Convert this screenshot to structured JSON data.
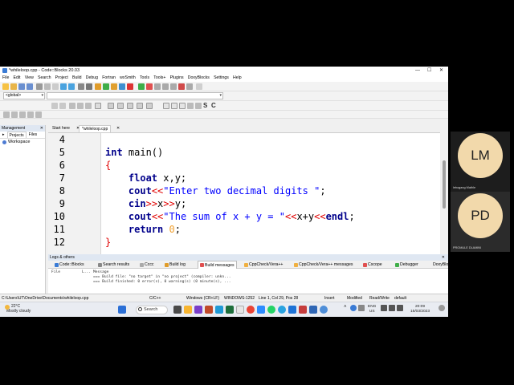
{
  "window": {
    "title": "*whileloop.cpp - Code::Blocks 20.03",
    "controls": [
      "—",
      "☐",
      "✕"
    ]
  },
  "menu": [
    "File",
    "Edit",
    "View",
    "Search",
    "Project",
    "Build",
    "Debug",
    "Fortran",
    "wxSmith",
    "Tools",
    "Tools+",
    "Plugins",
    "DoxyBlocks",
    "Settings",
    "Help"
  ],
  "toolbar": {
    "scope_combo": "<global>",
    "letters": [
      "S",
      "C"
    ]
  },
  "management": {
    "title": "Management",
    "close": "✕",
    "tabs": [
      "Projects",
      "Files"
    ],
    "arrow": "▸",
    "workspace_label": "Workspace"
  },
  "editor": {
    "tabs": [
      "Start here",
      "*whileloop.cpp"
    ],
    "line_numbers": [
      "4",
      "5",
      "6",
      "7",
      "8",
      "9",
      "10",
      "11",
      "12"
    ],
    "lines": [
      [],
      [
        {
          "c": "ty",
          "t": "int"
        },
        {
          "c": "",
          "t": " main()"
        }
      ],
      [
        {
          "c": "br",
          "t": "{"
        }
      ],
      [
        {
          "c": "",
          "t": "    "
        },
        {
          "c": "ty",
          "t": "float"
        },
        {
          "c": "",
          "t": " x,y;"
        }
      ],
      [
        {
          "c": "",
          "t": "    "
        },
        {
          "c": "kw",
          "t": "cout"
        },
        {
          "c": "op",
          "t": "<<"
        },
        {
          "c": "st",
          "t": "\"Enter two decimal digits \""
        },
        {
          "c": "",
          "t": ";"
        }
      ],
      [
        {
          "c": "",
          "t": "    "
        },
        {
          "c": "kw",
          "t": "cin"
        },
        {
          "c": "op",
          "t": ">>"
        },
        {
          "c": "",
          "t": "x"
        },
        {
          "c": "op",
          "t": ">>"
        },
        {
          "c": "",
          "t": "y;"
        }
      ],
      [
        {
          "c": "",
          "t": "    "
        },
        {
          "c": "kw",
          "t": "cout"
        },
        {
          "c": "op",
          "t": "<<"
        },
        {
          "c": "st",
          "t": "\"The sum of x + y = \""
        },
        {
          "c": "op",
          "t": "<<"
        },
        {
          "c": "",
          "t": "x+y"
        },
        {
          "c": "op",
          "t": "<<"
        },
        {
          "c": "kw",
          "t": "endl"
        },
        {
          "c": "",
          "t": ";"
        }
      ],
      [
        {
          "c": "",
          "t": "    "
        },
        {
          "c": "kw",
          "t": "return"
        },
        {
          "c": "",
          "t": " "
        },
        {
          "c": "nm",
          "t": "0"
        },
        {
          "c": "",
          "t": ";"
        }
      ],
      [
        {
          "c": "br",
          "t": "}"
        }
      ]
    ]
  },
  "logs": {
    "title": "Logs & others",
    "close": "✕",
    "tabs": [
      "Code::Blocks",
      "Search results",
      "Cccc",
      "Build log",
      "Build messages",
      "CppCheck/Vera++",
      "CppCheck/Vera++ messages",
      "Cscope",
      "Debugger",
      "DoxyBlocks"
    ],
    "columns": [
      "File",
      "L...",
      "Message"
    ],
    "rows": [
      "=== Build file: \"no target\" in \"no project\" (compiler: unkn...",
      "=== Build finished: 0 error(s), 0 warning(s) (0 minute(s), ..."
    ]
  },
  "status": {
    "path": "C:\\Users\\UT\\OneDrive\\Documents\\whileloop.cpp",
    "lang": "C/C++",
    "eol": "Windows (CR+LF)",
    "encoding": "WINDOWS-1252",
    "position": "Line 1, Col 29, Pos 28",
    "mode": "Insert",
    "modified": "Modified",
    "rw": "Read/Write",
    "default": "default"
  },
  "taskbar": {
    "temp": "22°C",
    "weather": "Mostly cloudy",
    "search": "Search",
    "lang": "ENG",
    "region": "US",
    "time": "20:09",
    "date": "15/03/2023"
  },
  "participants": [
    {
      "initials": "LM",
      "name": "lebogang Mathle"
    },
    {
      "initials": "PD",
      "name": "PROMULE DLAMINI"
    }
  ]
}
